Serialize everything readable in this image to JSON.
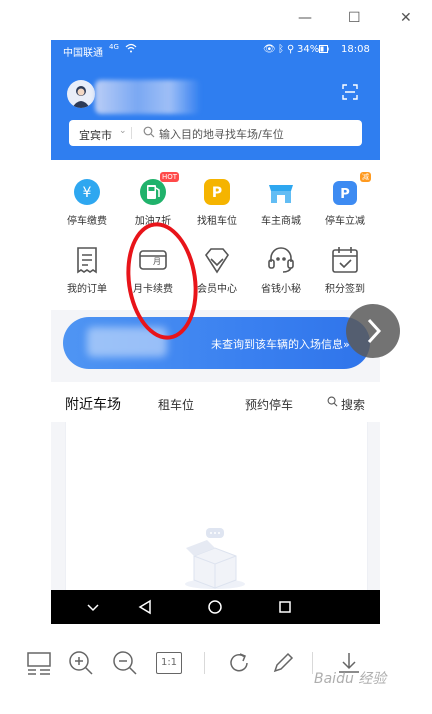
{
  "window": {
    "minimize_glyph": "—",
    "maximize_glyph": "☐",
    "close_glyph": "✕"
  },
  "status_bar": {
    "carrier": "中国联通",
    "network": "4G",
    "battery": "34%",
    "time": "18:08"
  },
  "header": {
    "city": "宜宾市",
    "search_placeholder": "输入目的地寻找车场/车位"
  },
  "services": [
    {
      "label": "停车缴费",
      "icon": "yen-icon",
      "color": "#2ea7f0"
    },
    {
      "label": "加油7折",
      "icon": "fuel-icon",
      "color": "#20b26b",
      "badge": "HOT"
    },
    {
      "label": "找租车位",
      "icon": "parking-p-icon",
      "color": "#f5b400"
    },
    {
      "label": "车主商城",
      "icon": "store-icon",
      "color": "#2ea7f0"
    },
    {
      "label": "停车立减",
      "icon": "parking-discount-icon",
      "color": "#3d8bf2",
      "badge": "减"
    },
    {
      "label": "我的订单",
      "icon": "receipt-icon",
      "color": "#555555"
    },
    {
      "label": "月卡续费",
      "icon": "monthly-card-icon",
      "color": "#555555",
      "card_text": "月"
    },
    {
      "label": "会员中心",
      "icon": "diamond-icon",
      "color": "#555555"
    },
    {
      "label": "省钱小秘",
      "icon": "headset-icon",
      "color": "#555555"
    },
    {
      "label": "积分签到",
      "icon": "calendar-check-icon",
      "color": "#555555"
    }
  ],
  "banner": {
    "text": "未查询到该车辆的入场信息»"
  },
  "tabs": {
    "nearby": "附近车场",
    "rent": "租车位",
    "reserve": "预约停车",
    "search": "搜索"
  },
  "toolbar": {
    "zoom_actual": "1:1",
    "watermark": "Baidu 经验"
  }
}
